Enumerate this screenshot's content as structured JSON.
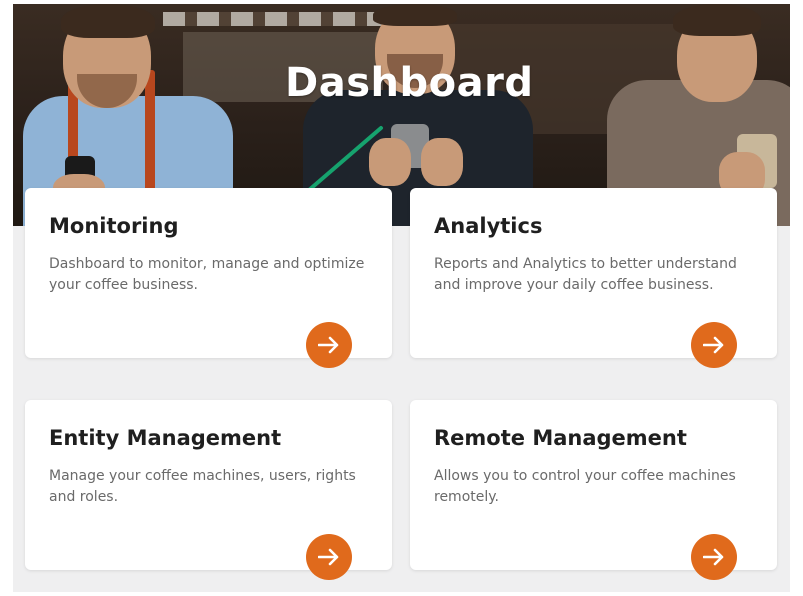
{
  "page": {
    "title": "Dashboard"
  },
  "cards": [
    {
      "title": "Monitoring",
      "description": "Dashboard to monitor, manage and optimize your coffee business."
    },
    {
      "title": "Analytics",
      "description": "Reports and Analytics to better understand and improve your daily coffee business."
    },
    {
      "title": "Entity Management",
      "description": "Manage your coffee machines, users, rights and roles."
    },
    {
      "title": "Remote Management",
      "description": "Allows you to control your coffee machines remotely."
    }
  ],
  "icons": {
    "card_action": "arrow-right-icon"
  },
  "colors": {
    "accent": "#e06a1c",
    "annotation": "#16a36e",
    "title": "#1f1f1f",
    "text": "#6a6a6a",
    "background": "#efeff0"
  }
}
